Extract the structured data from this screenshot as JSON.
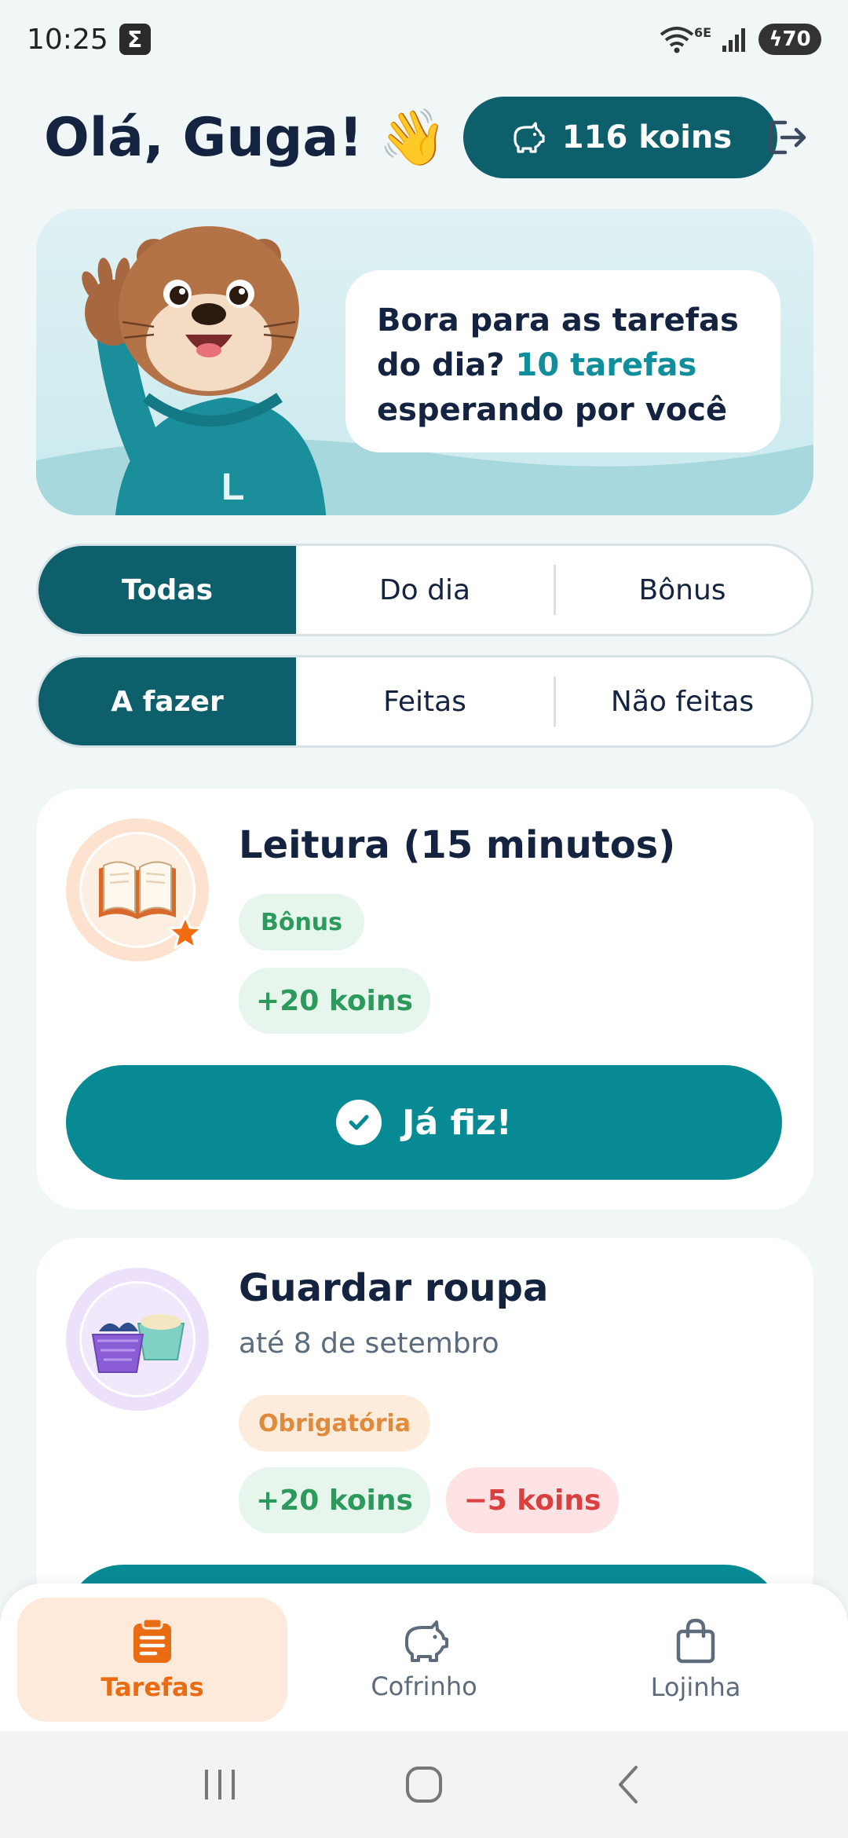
{
  "status_bar": {
    "time": "10:25",
    "app_icon_glyph": "Σ",
    "network_label": "6E",
    "battery": "70"
  },
  "header": {
    "greeting": "Olá, Guga!",
    "wave_emoji": "👋",
    "koins_balance": "116 koins"
  },
  "banner": {
    "message_part1": "Bora para as tarefas do dia?",
    "message_highlight": "10 tarefas",
    "message_part2": "esperando por você",
    "mascot_hoodie_letter": "L"
  },
  "filters": {
    "type": {
      "options": [
        "Todas",
        "Do dia",
        "Bônus"
      ],
      "selected": "Todas"
    },
    "status": {
      "options": [
        "A fazer",
        "Feitas",
        "Não feitas"
      ],
      "selected": "A fazer"
    }
  },
  "tasks": [
    {
      "title": "Leitura (15 minutos)",
      "icon": "book-icon",
      "tag": "Bônus",
      "reward": "+20 koins",
      "action": "Já fiz!"
    },
    {
      "title": "Guardar roupa",
      "icon": "laundry-baskets-icon",
      "due": "até 8 de setembro",
      "tag": "Obrigatória",
      "reward": "+20 koins",
      "penalty": "−5 koins"
    }
  ],
  "bottom_nav": {
    "items": [
      {
        "label": "Tarefas",
        "icon": "clipboard-icon",
        "active": true
      },
      {
        "label": "Cofrinho",
        "icon": "piggy-bank-icon",
        "active": false
      },
      {
        "label": "Lojinha",
        "icon": "shopping-bag-icon",
        "active": false
      }
    ]
  },
  "colors": {
    "primary_dark": "#0e5f6c",
    "primary": "#088a95",
    "accent_orange": "#ea6c12",
    "success": "#2d9a5d",
    "danger": "#d9403f",
    "background": "#f1f6f7"
  }
}
